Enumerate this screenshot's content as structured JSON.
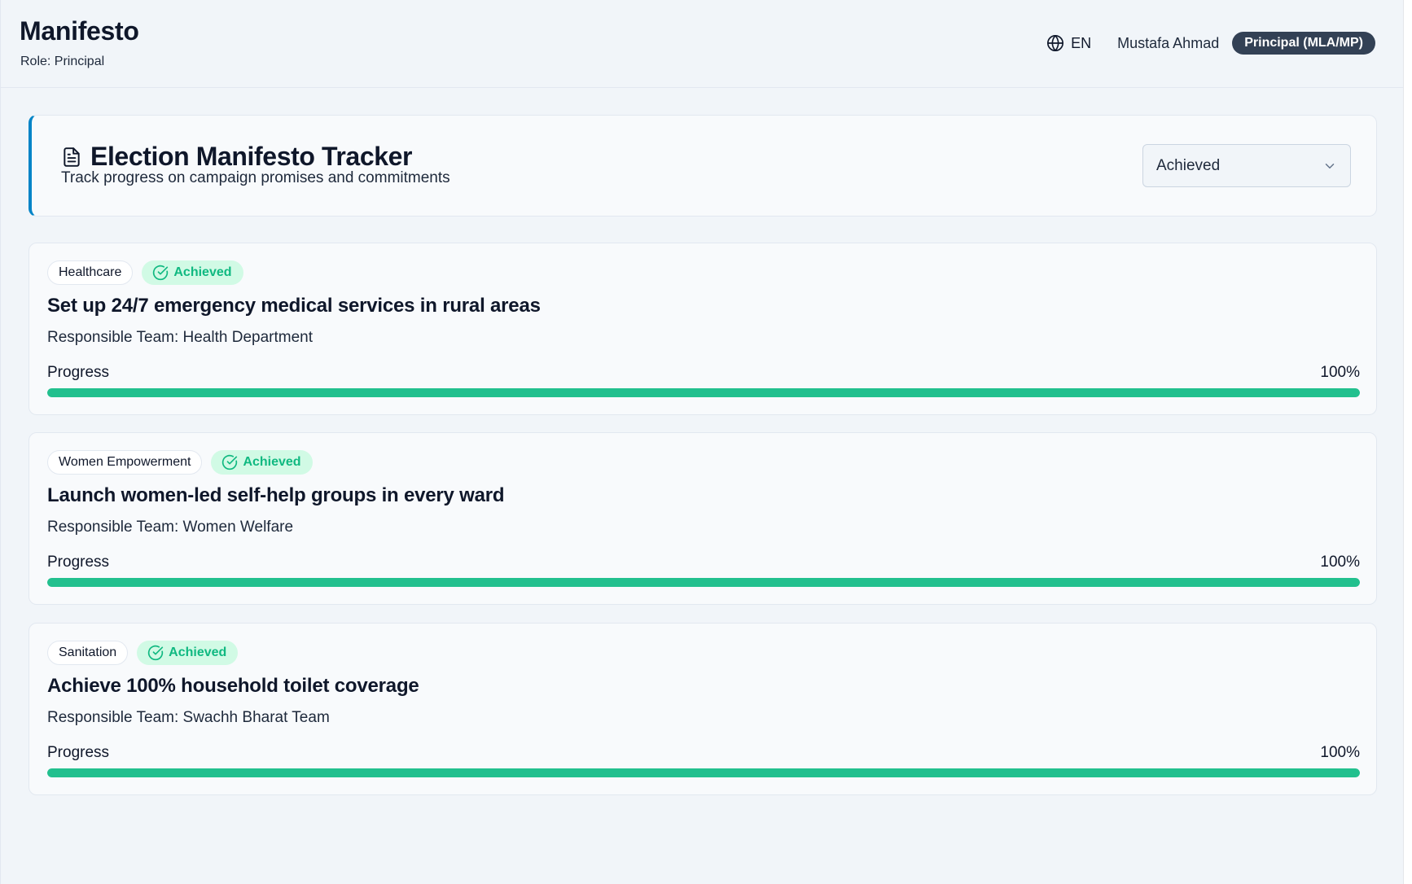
{
  "header": {
    "title": "Manifesto",
    "role_text": "Role: Principal",
    "language": "EN",
    "user_name": "Mustafa Ahmad",
    "user_role_badge": "Principal (MLA/MP)"
  },
  "tracker": {
    "title": "Election Manifesto Tracker",
    "subtitle": "Track progress on campaign promises and commitments",
    "filter": {
      "selected": "Achieved"
    }
  },
  "promises": [
    {
      "category": "Healthcare",
      "status": "Achieved",
      "title": "Set up 24/7 emergency medical services in rural areas",
      "team": "Responsible Team: Health Department",
      "progress_label": "Progress",
      "progress_text": "100%",
      "progress": 1.0
    },
    {
      "category": "Women Empowerment",
      "status": "Achieved",
      "title": "Launch women-led self-help groups in every ward",
      "team": "Responsible Team: Women Welfare",
      "progress_label": "Progress",
      "progress_text": "100%",
      "progress": 1.0
    },
    {
      "category": "Sanitation",
      "status": "Achieved",
      "title": "Achieve 100% household toilet coverage",
      "team": "Responsible Team: Swachh Bharat Team",
      "progress_label": "Progress",
      "progress_text": "100%",
      "progress": 1.0
    }
  ],
  "colors": {
    "accent": "#0284c7",
    "achieved_text": "#10b981",
    "achieved_bg": "#d1fae5",
    "progress_fill": "#22c08e",
    "badge_bg": "#334155"
  },
  "icons": {
    "language": "globe-icon",
    "tracker": "document-icon",
    "select": "chevron-down-icon",
    "status": "check-circle-icon"
  }
}
